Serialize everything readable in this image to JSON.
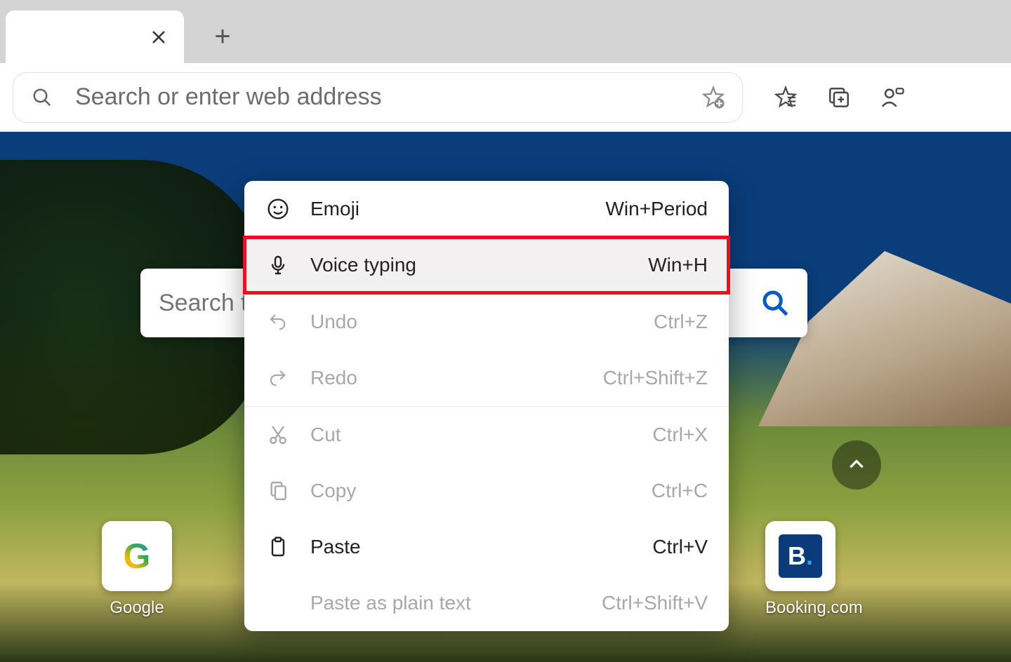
{
  "omnibox": {
    "placeholder": "Search or enter web address"
  },
  "searchbar": {
    "placeholder": "Search the web"
  },
  "tiles": {
    "google": {
      "label": "Google"
    },
    "booking": {
      "label": "Booking.com",
      "logo_letter": "B"
    }
  },
  "context_menu": {
    "items": [
      {
        "icon": "emoji-icon",
        "label": "Emoji",
        "shortcut": "Win+Period",
        "enabled": true,
        "highlight": false
      },
      {
        "icon": "microphone-icon",
        "label": "Voice typing",
        "shortcut": "Win+H",
        "enabled": true,
        "highlight": true
      },
      {
        "separator": true
      },
      {
        "icon": "undo-icon",
        "label": "Undo",
        "shortcut": "Ctrl+Z",
        "enabled": false
      },
      {
        "icon": "redo-icon",
        "label": "Redo",
        "shortcut": "Ctrl+Shift+Z",
        "enabled": false
      },
      {
        "separator": true
      },
      {
        "icon": "cut-icon",
        "label": "Cut",
        "shortcut": "Ctrl+X",
        "enabled": false
      },
      {
        "icon": "copy-icon",
        "label": "Copy",
        "shortcut": "Ctrl+C",
        "enabled": false
      },
      {
        "icon": "paste-icon",
        "label": "Paste",
        "shortcut": "Ctrl+V",
        "enabled": true
      },
      {
        "icon": "paste-plain-icon",
        "label": "Paste as plain text",
        "shortcut": "Ctrl+Shift+V",
        "enabled": false
      }
    ]
  }
}
